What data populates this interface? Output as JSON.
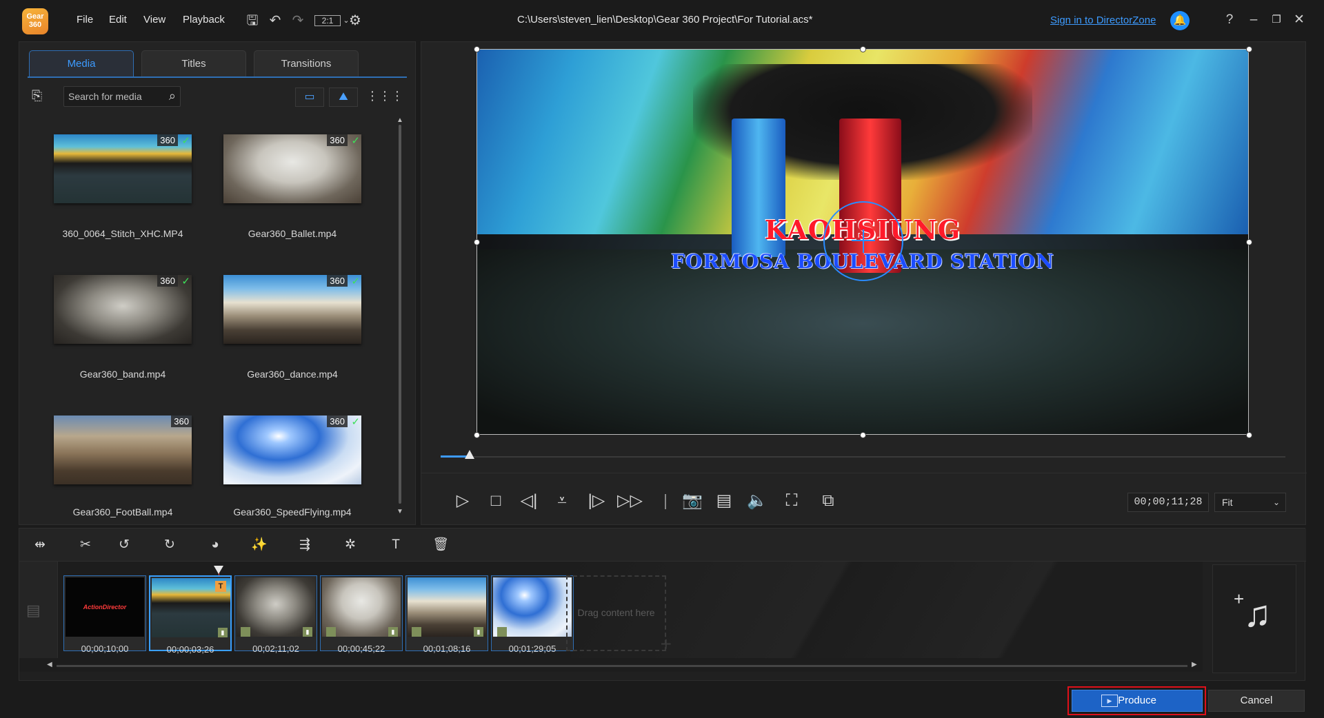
{
  "app": {
    "logo_text": "Gear 360",
    "file_path": "C:\\Users\\steven_lien\\Desktop\\Gear 360 Project\\For Tutorial.acs*",
    "sign_in_label": "Sign in to DirectorZone"
  },
  "menu": {
    "file": "File",
    "edit": "Edit",
    "view": "View",
    "playback": "Playback"
  },
  "toolbar": {
    "ratio_label": "2:1",
    "help": "?"
  },
  "library": {
    "tabs": [
      {
        "label": "Media",
        "active": true
      },
      {
        "label": "Titles",
        "active": false
      },
      {
        "label": "Transitions",
        "active": false
      }
    ],
    "search_placeholder": "Search for media",
    "badge_360": "360",
    "items": [
      {
        "name": "360_0064_Stitch_XHC.MP4",
        "checked": true
      },
      {
        "name": "Gear360_Ballet.mp4",
        "checked": true
      },
      {
        "name": "Gear360_band.mp4",
        "checked": true
      },
      {
        "name": "Gear360_dance.mp4",
        "checked": true
      },
      {
        "name": "Gear360_FootBall.mp4",
        "checked": false
      },
      {
        "name": "Gear360_SpeedFlying.mp4",
        "checked": true
      }
    ]
  },
  "preview": {
    "title_line1": "KAOHSIUNG",
    "title_line2": "FORMOSA BOULEVARD STATION",
    "timecode": "00;00;11;28",
    "zoom_value": "Fit",
    "seek_fraction": 0.034
  },
  "timeline": {
    "title_badge": "T",
    "intro_text": "ActionDirector",
    "clips": [
      {
        "duration": "00;00;10;00"
      },
      {
        "duration": "00;00;03;26"
      },
      {
        "duration": "00;02;11;02"
      },
      {
        "duration": "00;00;45;22"
      },
      {
        "duration": "00;01;08;16"
      },
      {
        "duration": "00;01;29;05"
      }
    ],
    "drop_label": "Drag content here"
  },
  "footer": {
    "produce_label": "Produce",
    "cancel_label": "Cancel"
  },
  "colors": {
    "accent": "#1d63c6",
    "link": "#3d9bff",
    "highlight_outline": "#e0101a",
    "check": "#3ee05a"
  }
}
